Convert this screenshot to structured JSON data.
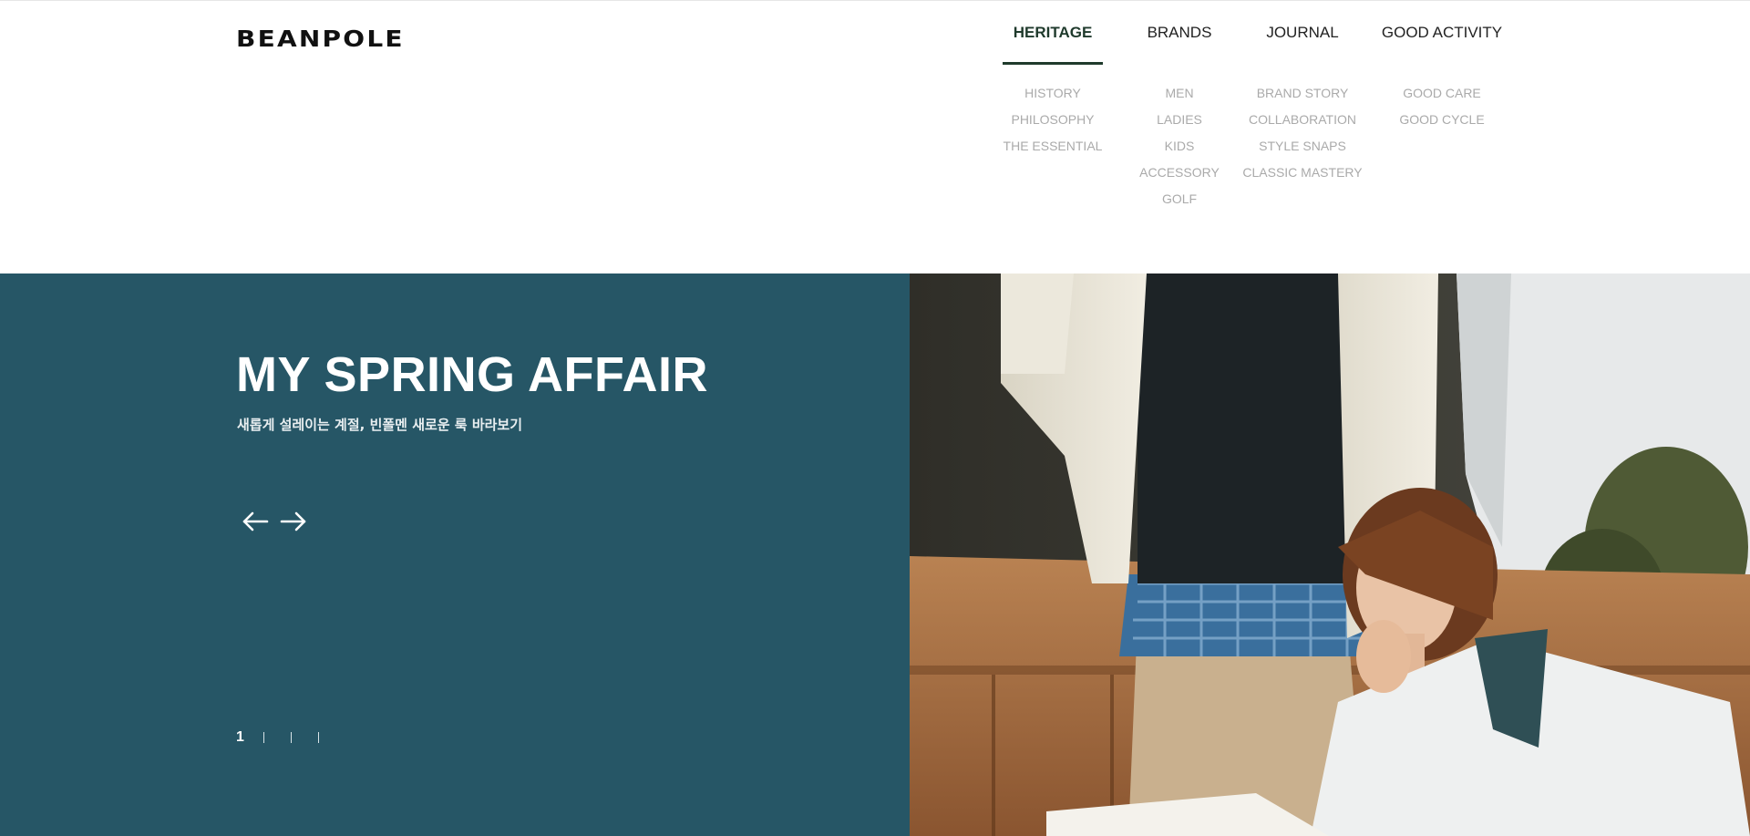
{
  "brand": {
    "logo": "BEANPOLE"
  },
  "nav": [
    {
      "label": "HERITAGE",
      "active": true,
      "items": [
        "HISTORY",
        "PHILOSOPHY",
        "THE ESSENTIAL"
      ]
    },
    {
      "label": "BRANDS",
      "active": false,
      "items": [
        "MEN",
        "LADIES",
        "KIDS",
        "ACCESSORY",
        "GOLF"
      ]
    },
    {
      "label": "JOURNAL",
      "active": false,
      "items": [
        "BRAND STORY",
        "COLLABORATION",
        "STYLE SNAPS",
        "CLASSIC MASTERY"
      ]
    },
    {
      "label": "GOOD ACTIVITY",
      "active": false,
      "items": [
        "GOOD CARE",
        "GOOD CYCLE"
      ]
    }
  ],
  "hero": {
    "title": "MY SPRING AFFAIR",
    "subtitle": "새롭게 설레이는 계절, 빈폴멘 새로운 룩 바라보기",
    "prev_icon": "arrow-left-icon",
    "next_icon": "arrow-right-icon",
    "current_slide": "1",
    "background_color": "#265666"
  },
  "colors": {
    "accent": "#1f3a2c",
    "submenu": "#aaaaaa"
  }
}
